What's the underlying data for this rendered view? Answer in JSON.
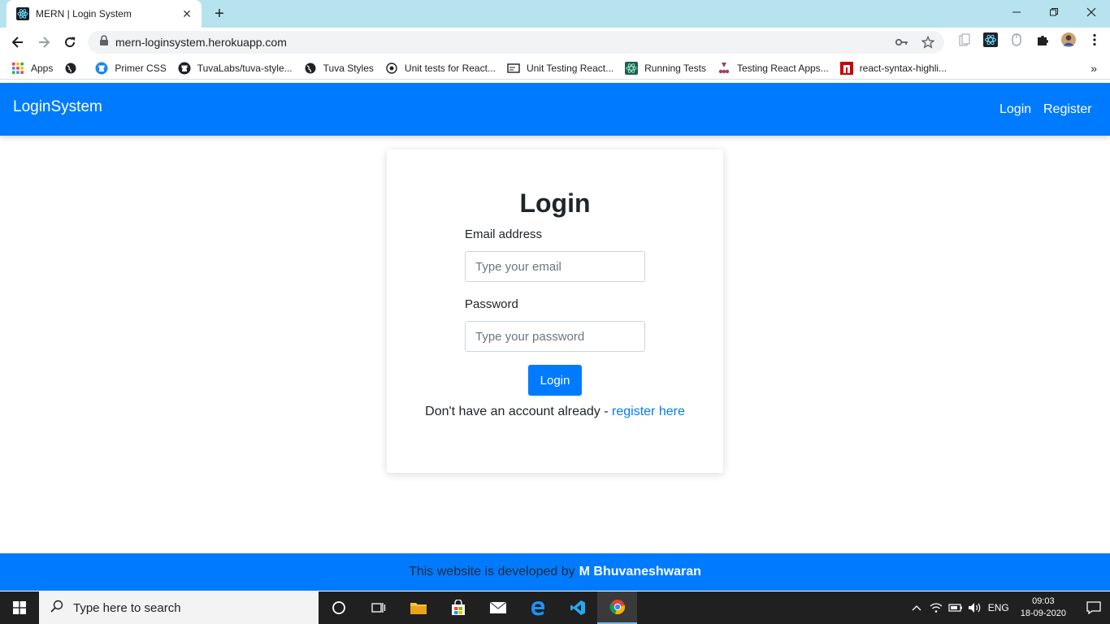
{
  "browser": {
    "tab_title": "MERN | Login System",
    "tab_close": "✕",
    "new_tab": "+",
    "url": "mern-loginsystem.herokuapp.com",
    "bookmarks": [
      {
        "label": "Apps",
        "icon": "apps-grid-icon"
      },
      {
        "label": "",
        "icon": "globe-icon"
      },
      {
        "label": "Primer CSS",
        "icon": "github-icon"
      },
      {
        "label": "TuvaLabs/tuva-style...",
        "icon": "github-icon"
      },
      {
        "label": "Tuva Styles",
        "icon": "globe-icon"
      },
      {
        "label": "Unit tests for React...",
        "icon": "site-icon"
      },
      {
        "label": "Unit Testing React...",
        "icon": "site-icon"
      },
      {
        "label": "Running Tests",
        "icon": "react-icon"
      },
      {
        "label": "Testing React Apps...",
        "icon": "jest-icon"
      },
      {
        "label": "react-syntax-highli...",
        "icon": "npm-icon"
      }
    ],
    "bookmarks_more": "»"
  },
  "navbar": {
    "brand": "LoginSystem",
    "links": [
      "Login",
      "Register"
    ]
  },
  "login_form": {
    "title": "Login",
    "email_label": "Email address",
    "email_placeholder": "Type your email",
    "password_label": "Password",
    "password_placeholder": "Type your password",
    "submit_label": "Login",
    "signup_prompt": "Don't have an account already - ",
    "signup_link": "register here"
  },
  "footer": {
    "text": "This website is developed by",
    "author": "M Bhuvaneshwaran"
  },
  "taskbar": {
    "search_placeholder": "Type here to search",
    "language": "ENG",
    "time": "09:03",
    "date": "18-09-2020"
  },
  "colors": {
    "primary": "#007bff",
    "tabstrip": "#b7e3ee",
    "taskbar": "#202020"
  }
}
